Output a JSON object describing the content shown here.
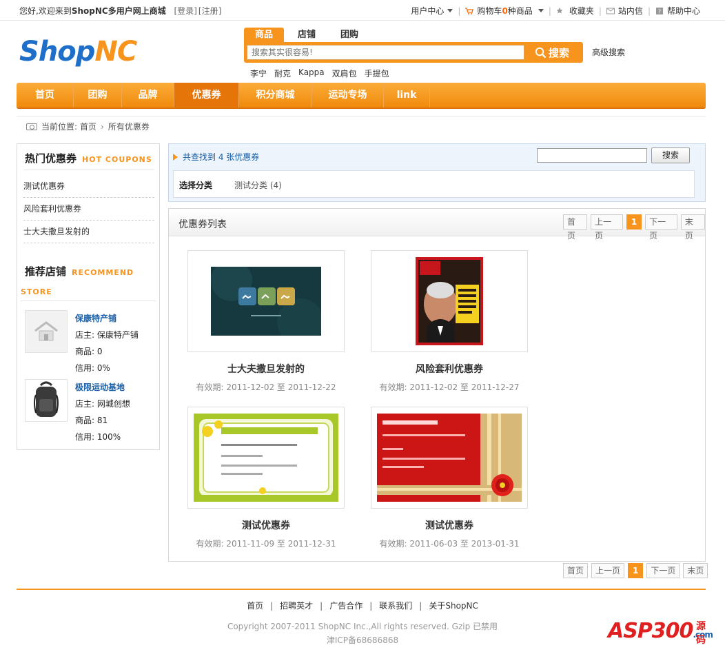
{
  "topbar": {
    "welcome": "您好,欢迎来到",
    "site": "ShopNC多用户网上商城",
    "login": "[登录]",
    "register": "[注册]",
    "user_center": "用户中心",
    "cart_prefix": "购物车",
    "cart_count": "0",
    "cart_suffix": "种商品",
    "favorites": "收藏夹",
    "messages": "站内信",
    "help": "帮助中心"
  },
  "logo": {
    "part1": "Shop",
    "part2": "NC"
  },
  "search": {
    "tabs": [
      "商品",
      "店铺",
      "团购"
    ],
    "placeholder": "搜索其实很容易!",
    "button": "搜索",
    "advanced": "高级搜索",
    "hotwords": [
      "李宁",
      "耐克",
      "Kappa",
      "双肩包",
      "手提包"
    ]
  },
  "nav": {
    "items": [
      "首页",
      "团购",
      "品牌",
      "优惠券",
      "积分商城",
      "运动专场",
      "link"
    ],
    "active": "优惠券"
  },
  "breadcrumb": {
    "prefix": "当前位置:",
    "home": "首页",
    "current": "所有优惠券"
  },
  "sidebar": {
    "hot_title": "热门优惠券",
    "hot_en": "HOT COUPONS",
    "hot_items": [
      "测试优惠券",
      "风险套利优惠券",
      "士大夫撒旦发射的"
    ],
    "rec_title": "推荐店铺",
    "rec_en1": "RECOMMEND",
    "rec_en2": "STORE",
    "stores": [
      {
        "name": "保康特产铺",
        "owner": "店主: 保康特产铺",
        "goods": "商品: 0",
        "credit": "信用: 0%"
      },
      {
        "name": "极限运动基地",
        "owner": "店主: 网城创想",
        "goods": "商品: 81",
        "credit": "信用: 100%"
      }
    ]
  },
  "filter": {
    "found": "共查找到 4 张优惠券",
    "search_button": "搜索",
    "category_label": "选择分类",
    "category_value": "测试分类 (4)"
  },
  "list": {
    "title": "优惠券列表",
    "pager": [
      "首页",
      "上一页",
      "1",
      "下一页",
      "末页"
    ],
    "coupons": [
      {
        "name": "士大夫撒旦发射的",
        "date": "有效期: 2011-12-02 至 2011-12-22"
      },
      {
        "name": "风险套利优惠券",
        "date": "有效期: 2011-12-02 至 2011-12-27"
      },
      {
        "name": "测试优惠券",
        "date": "有效期: 2011-11-09 至 2011-12-31"
      },
      {
        "name": "测试优惠券",
        "date": "有效期: 2011-06-03 至 2013-01-31"
      }
    ]
  },
  "footer": {
    "links": [
      "首页",
      "招聘英才",
      "广告合作",
      "联系我们",
      "关于ShopNC"
    ],
    "copyright": "Copyright 2007-2011 ShopNC Inc.,All rights reserved. Gzip 已禁用",
    "icp": "津ICP备68686868"
  },
  "watermark": {
    "text": "ASP300",
    "sub": "源码",
    "tld": ".com"
  },
  "colors": {
    "accent": "#f7941d",
    "link": "#1a60a8",
    "nav_active": "#e57508"
  }
}
